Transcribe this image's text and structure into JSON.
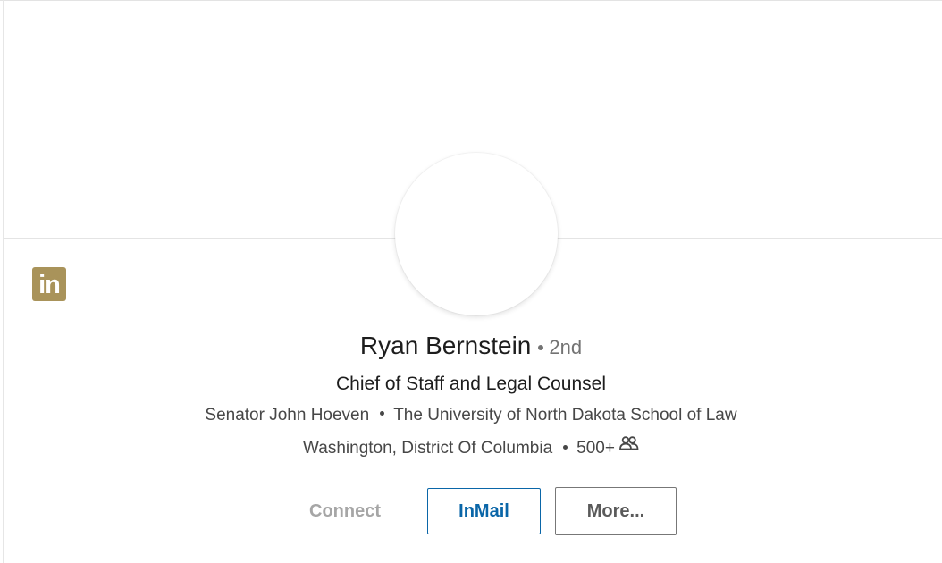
{
  "logo": {
    "text": "in",
    "color": "#a9935a"
  },
  "profile": {
    "name": "Ryan Bernstein",
    "degree": "2nd",
    "headline": "Chief of Staff and Legal Counsel",
    "current_company": "Senator John Hoeven",
    "education": "The University of North Dakota School of Law",
    "location": "Washington, District Of Columbia",
    "connections": "500+",
    "connections_icon": "people-icon"
  },
  "actions": {
    "connect_label": "Connect",
    "inmail_label": "InMail",
    "more_label": "More..."
  },
  "colors": {
    "accent": "#0a66a8",
    "logo": "#a9935a",
    "disabled_text": "#a6a6a6"
  }
}
